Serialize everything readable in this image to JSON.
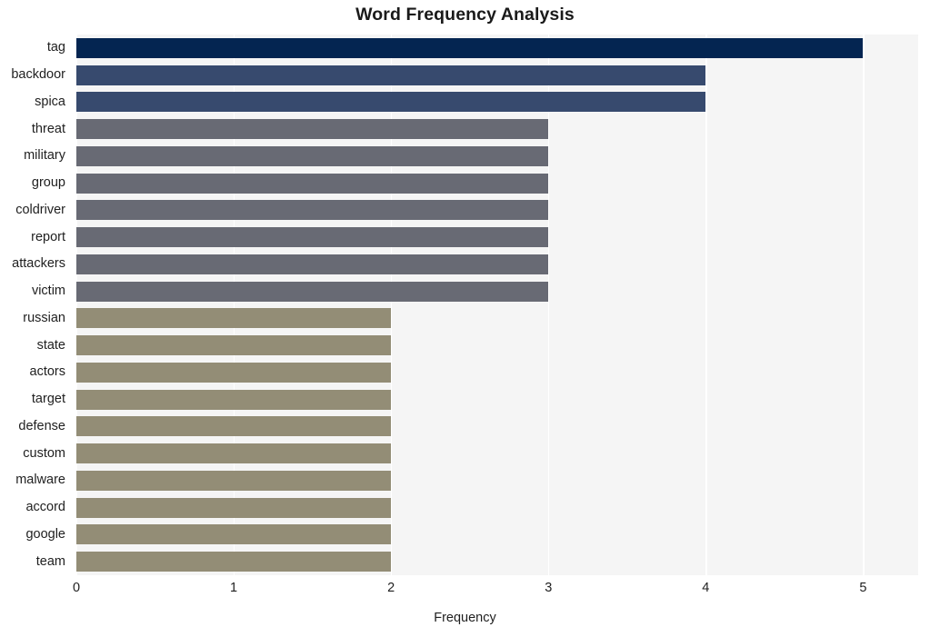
{
  "chart_data": {
    "type": "bar",
    "orientation": "horizontal",
    "title": "Word Frequency Analysis",
    "xlabel": "Frequency",
    "ylabel": "",
    "xlim": [
      0,
      5.35
    ],
    "ylim": [
      0,
      20
    ],
    "grid": "vertical-white",
    "legend": "none",
    "x_ticks": [
      0,
      1,
      2,
      3,
      4,
      5
    ],
    "x_tick_labels": [
      "0",
      "1",
      "2",
      "3",
      "4",
      "5"
    ],
    "categories": [
      "tag",
      "backdoor",
      "spica",
      "threat",
      "military",
      "group",
      "coldriver",
      "report",
      "attackers",
      "victim",
      "russian",
      "state",
      "actors",
      "target",
      "defense",
      "custom",
      "malware",
      "accord",
      "google",
      "team"
    ],
    "values": [
      5,
      4,
      4,
      3,
      3,
      3,
      3,
      3,
      3,
      3,
      2,
      2,
      2,
      2,
      2,
      2,
      2,
      2,
      2,
      2
    ],
    "bar_colors": [
      "#042551",
      "#374a6e",
      "#374a6e",
      "#686a74",
      "#686a74",
      "#686a74",
      "#686a74",
      "#686a74",
      "#686a74",
      "#686a74",
      "#938d76",
      "#938d76",
      "#938d76",
      "#938d76",
      "#938d76",
      "#938d76",
      "#938d76",
      "#938d76",
      "#938d76",
      "#938d76"
    ]
  },
  "colors": {
    "plot_background": "#f5f5f5",
    "figure_background": "#ffffff",
    "gridline": "#ffffff",
    "text": "#1f1f1f",
    "title": "#1a1a1a"
  }
}
